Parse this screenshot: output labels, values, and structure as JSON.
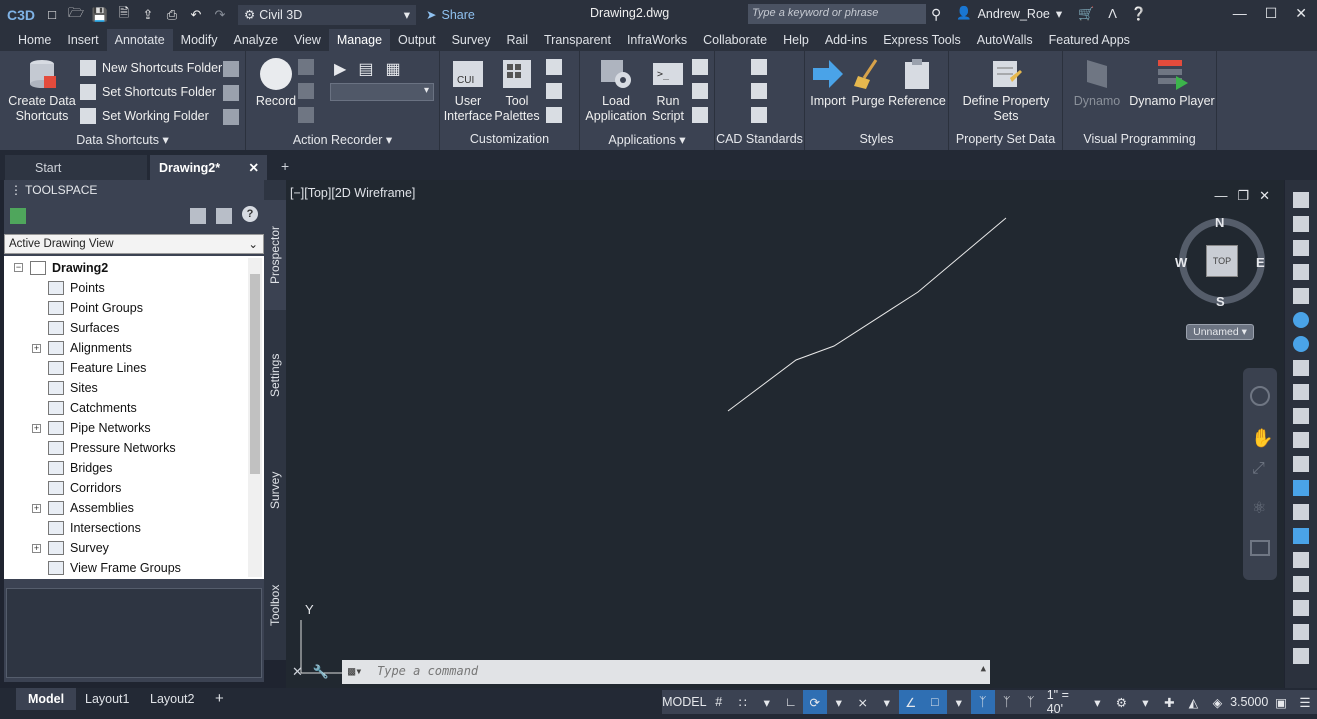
{
  "app": {
    "logo": "C3D",
    "workspace": "Civil 3D",
    "share_label": "Share",
    "document_title": "Drawing2.dwg",
    "search_placeholder": "Type a keyword or phrase",
    "user": "Andrew_Roe"
  },
  "ribbon_tabs": [
    "Home",
    "Insert",
    "Annotate",
    "Modify",
    "Analyze",
    "View",
    "Manage",
    "Output",
    "Survey",
    "Rail",
    "Transparent",
    "InfraWorks",
    "Collaborate",
    "Help",
    "Add-ins",
    "Express Tools",
    "AutoWalls",
    "Featured Apps"
  ],
  "active_tab": "Manage",
  "ribbon": {
    "data_shortcuts": {
      "create": "Create Data\nShortcuts",
      "new_folder": "New Shortcuts Folder",
      "set_folder": "Set Shortcuts Folder",
      "set_working": "Set Working Folder",
      "title": "Data Shortcuts"
    },
    "action_recorder": {
      "record": "Record",
      "title": "Action Recorder"
    },
    "customization": {
      "user_interface": "User\nInterface",
      "tool_palettes": "Tool\nPalettes",
      "title": "Customization"
    },
    "applications": {
      "load": "Load\nApplication",
      "run": "Run\nScript",
      "title": "Applications"
    },
    "cad_standards": {
      "title": "CAD Standards"
    },
    "styles": {
      "import": "Import",
      "purge": "Purge",
      "reference": "Reference",
      "title": "Styles"
    },
    "property_set": {
      "define": "Define Property Sets",
      "title": "Property Set Data"
    },
    "visual_programming": {
      "dynamo": "Dynamo",
      "player": "Dynamo Player",
      "title": "Visual Programming"
    }
  },
  "doc_tabs": {
    "start": "Start",
    "current": "Drawing2*"
  },
  "toolspace": {
    "title": "TOOLSPACE",
    "view_selector": "Active Drawing View",
    "root": "Drawing2",
    "items": [
      {
        "label": "Points",
        "expandable": false
      },
      {
        "label": "Point Groups",
        "expandable": false
      },
      {
        "label": "Surfaces",
        "expandable": false
      },
      {
        "label": "Alignments",
        "expandable": true
      },
      {
        "label": "Feature Lines",
        "expandable": false
      },
      {
        "label": "Sites",
        "expandable": false
      },
      {
        "label": "Catchments",
        "expandable": false
      },
      {
        "label": "Pipe Networks",
        "expandable": true
      },
      {
        "label": "Pressure Networks",
        "expandable": false
      },
      {
        "label": "Bridges",
        "expandable": false
      },
      {
        "label": "Corridors",
        "expandable": false
      },
      {
        "label": "Assemblies",
        "expandable": true
      },
      {
        "label": "Intersections",
        "expandable": false
      },
      {
        "label": "Survey",
        "expandable": true
      },
      {
        "label": "View Frame Groups",
        "expandable": false
      }
    ],
    "side_tabs": [
      "Prospector",
      "Settings",
      "Survey",
      "Toolbox"
    ]
  },
  "viewport": {
    "label": "[−][Top][2D Wireframe]",
    "compass": {
      "n": "N",
      "s": "S",
      "e": "E",
      "w": "W",
      "top": "TOP"
    },
    "ucs_name": "Unnamed",
    "axis_y": "Y",
    "command_placeholder": "Type a command"
  },
  "layouts": [
    "Model",
    "Layout1",
    "Layout2"
  ],
  "status": {
    "model": "MODEL",
    "scale": "1\" = 40'",
    "value": "3.5000"
  },
  "colors": {
    "accent": "#2f6fb3",
    "ribbon_bg": "#3b4252",
    "canvas_bg": "#212830"
  }
}
